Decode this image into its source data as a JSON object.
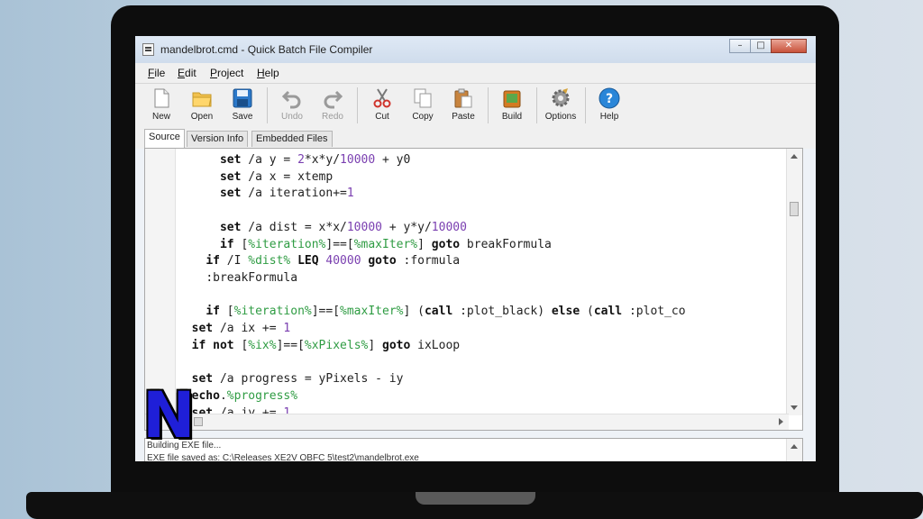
{
  "window": {
    "title": "mandelbrot.cmd - Quick Batch File Compiler",
    "controls": [
      "–",
      "□",
      "✕"
    ]
  },
  "menu": [
    {
      "underline": "F",
      "rest": "ile"
    },
    {
      "underline": "E",
      "rest": "dit"
    },
    {
      "underline": "P",
      "rest": "roject"
    },
    {
      "underline": "H",
      "rest": "elp"
    }
  ],
  "toolbar": {
    "new": "New",
    "open": "Open",
    "save": "Save",
    "undo": "Undo",
    "redo": "Redo",
    "cut": "Cut",
    "copy": "Copy",
    "paste": "Paste",
    "build": "Build",
    "options": "Options",
    "help": "Help"
  },
  "tabs": [
    "Source",
    "Version Info",
    "Embedded Files"
  ],
  "output": {
    "line1": "Building EXE file...",
    "line2": "EXE file saved as: C:\\Releases XE2V OBFC 5\\test2\\mandelbrot.exe"
  },
  "logo": {
    "letter": "N",
    "color": "#1f1fd8"
  },
  "colors": {
    "number": "#7a3fb0",
    "variable": "#2f9c43"
  }
}
